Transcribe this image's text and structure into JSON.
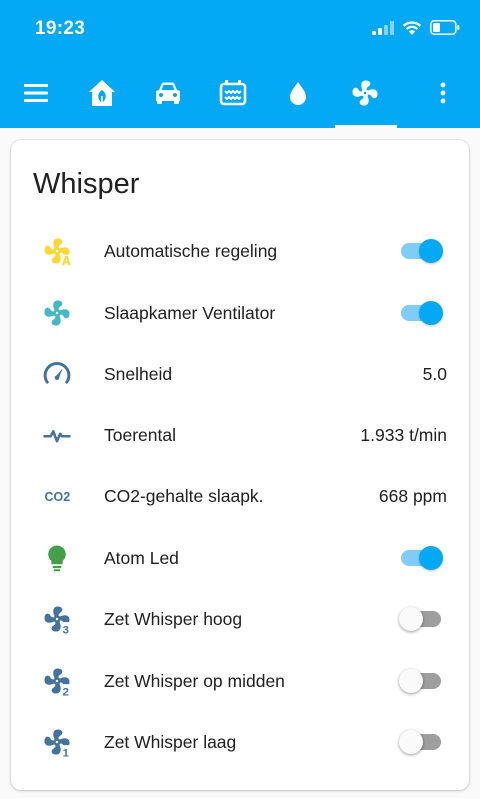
{
  "status_bar": {
    "time": "19:23"
  },
  "card": {
    "title": "Whisper",
    "rows": [
      {
        "label": "Automatische regeling",
        "icon": "fan-auto-icon",
        "icon_color": "#fdd835",
        "type": "toggle",
        "on": true
      },
      {
        "label": "Slaapkamer Ventilator",
        "icon": "fan-icon",
        "icon_color": "#44b9c6",
        "type": "toggle",
        "on": true
      },
      {
        "label": "Snelheid",
        "icon": "speedometer-icon",
        "icon_color": "#44739e",
        "type": "value",
        "value": "5.0"
      },
      {
        "label": "Toerental",
        "icon": "pulse-icon",
        "icon_color": "#44739e",
        "type": "value",
        "value": "1.933 t/min"
      },
      {
        "label": "CO2-gehalte slaapk.",
        "icon": "co2-icon",
        "icon_color": "#44739e",
        "type": "value",
        "value": "668 ppm",
        "icon_text": "CO2"
      },
      {
        "label": "Atom Led",
        "icon": "lightbulb-icon",
        "icon_color": "#43a047",
        "type": "toggle",
        "on": true
      },
      {
        "label": "Zet Whisper hoog",
        "icon": "fan-speed-3-icon",
        "icon_color": "#44739e",
        "type": "toggle",
        "on": false,
        "icon_digit": "3"
      },
      {
        "label": "Zet Whisper op midden",
        "icon": "fan-speed-2-icon",
        "icon_color": "#44739e",
        "type": "toggle",
        "on": false,
        "icon_digit": "2"
      },
      {
        "label": "Zet Whisper laag",
        "icon": "fan-speed-1-icon",
        "icon_color": "#44739e",
        "type": "toggle",
        "on": false,
        "icon_digit": "1"
      }
    ]
  }
}
